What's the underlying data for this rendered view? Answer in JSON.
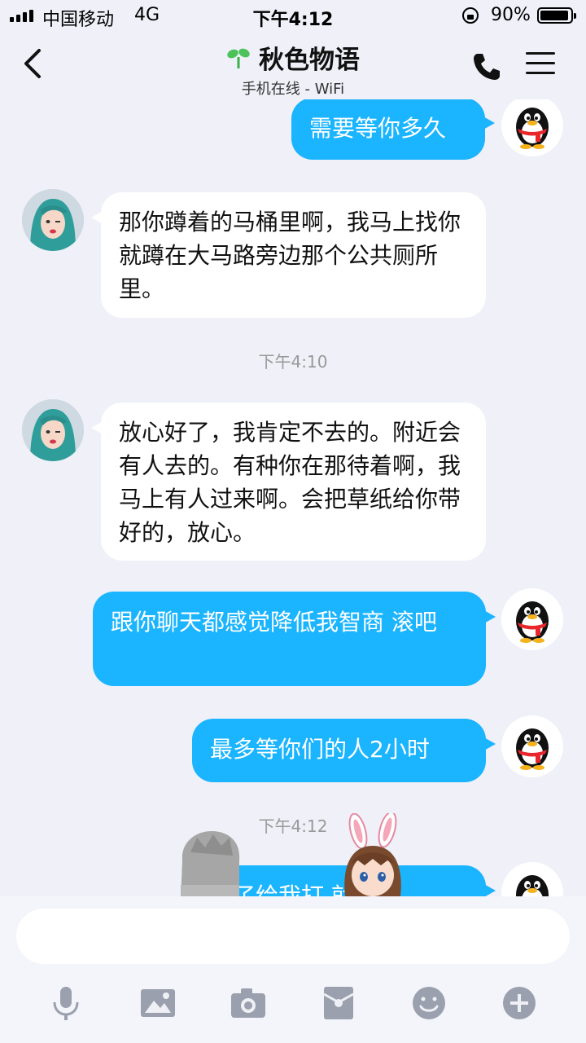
{
  "status_bar": {
    "carrier": "中国移动",
    "network": "4G",
    "time": "下午4:12",
    "battery_percent": "90%"
  },
  "header": {
    "title": "秋色物语",
    "subtitle": "手机在线 - WiFi"
  },
  "colors": {
    "outgoing_bubble": "#1ab4ff",
    "incoming_bubble": "#ffffff",
    "background": "#eff0f8"
  },
  "messages": [
    {
      "direction": "out",
      "text": "需要等你多久"
    },
    {
      "direction": "in",
      "text": "那你蹲着的马桶里啊，我马上找你就蹲在大马路旁边那个公共厕所里。"
    },
    {
      "direction": "in",
      "text": "放心好了，我肯定不去的。附近会有人去的。有种你在那待着啊，我马上有人过来啊。会把草纸给你带好的，放心。"
    },
    {
      "direction": "out",
      "text": "跟你聊天都感觉降低我智商 滚吧"
    },
    {
      "direction": "out",
      "text": "最多等你们的人2小时"
    },
    {
      "direction": "out",
      "text": "了给我打  就行"
    }
  ],
  "timestamps": [
    "下午4:10",
    "下午4:12"
  ],
  "input": {
    "placeholder": ""
  },
  "toolbar": {
    "icons": [
      "microphone-icon",
      "image-icon",
      "camera-icon",
      "red-packet-icon",
      "emoji-icon",
      "plus-icon"
    ]
  }
}
